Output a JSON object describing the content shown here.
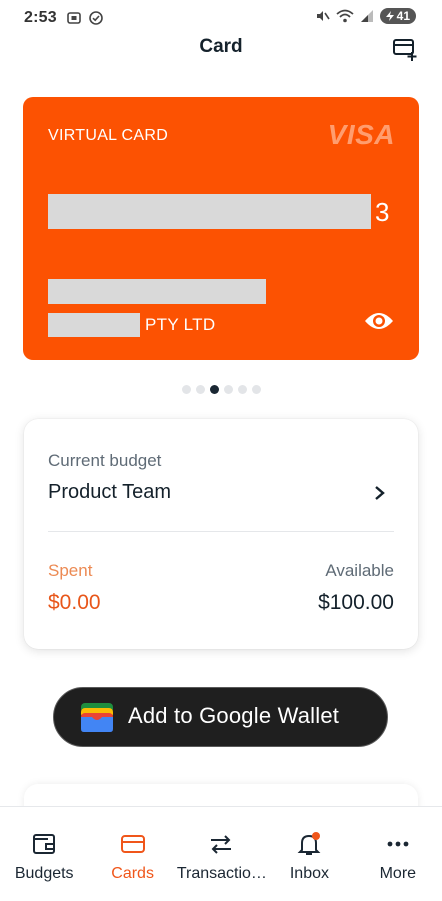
{
  "status_bar": {
    "time": "2:53",
    "battery": "41"
  },
  "header": {
    "title": "Card"
  },
  "card": {
    "kind": "VIRTUAL CARD",
    "network": "VISA",
    "number_last_visible": "3",
    "company_suffix": "PTY LTD",
    "color": "#fc5202"
  },
  "carousel": {
    "count": 6,
    "active_index": 2
  },
  "budget": {
    "label": "Current budget",
    "name": "Product Team",
    "spent_label": "Spent",
    "spent_value": "$0.00",
    "available_label": "Available",
    "available_value": "$100.00"
  },
  "wallet_button": {
    "label": "Add to Google Wallet"
  },
  "bottom_nav": {
    "items": [
      {
        "label": "Budgets",
        "icon": "wallet-icon"
      },
      {
        "label": "Cards",
        "icon": "card-icon",
        "active": true
      },
      {
        "label": "Transactio…",
        "icon": "transfer-arrows-icon"
      },
      {
        "label": "Inbox",
        "icon": "bell-icon"
      },
      {
        "label": "More",
        "icon": "more-dots-icon"
      }
    ]
  },
  "colors": {
    "accent": "#f0561a",
    "text": "#14212b"
  }
}
